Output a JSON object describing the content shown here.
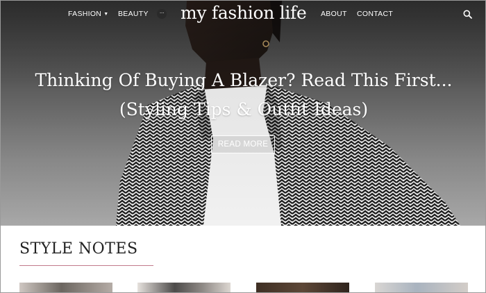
{
  "site": {
    "logo": "my fashion life"
  },
  "nav": {
    "left": [
      {
        "label": "FASHION",
        "has_dropdown": true
      },
      {
        "label": "BEAUTY",
        "has_dropdown": false
      }
    ],
    "more_icon": "ellipsis-icon",
    "right": [
      {
        "label": "ABOUT"
      },
      {
        "label": "CONTACT"
      }
    ],
    "search_icon": "search-icon"
  },
  "hero": {
    "headline_line1": "Thinking Of Buying A Blazer? Read This First...",
    "headline_line2": "(Styling Tips & Outfit Ideas)",
    "cta_label": "READ MORE"
  },
  "section": {
    "title": "STYLE NOTES",
    "accent_color": "#c27a8b"
  },
  "colors": {
    "text_on_hero": "#ffffff",
    "section_title": "#222222"
  }
}
